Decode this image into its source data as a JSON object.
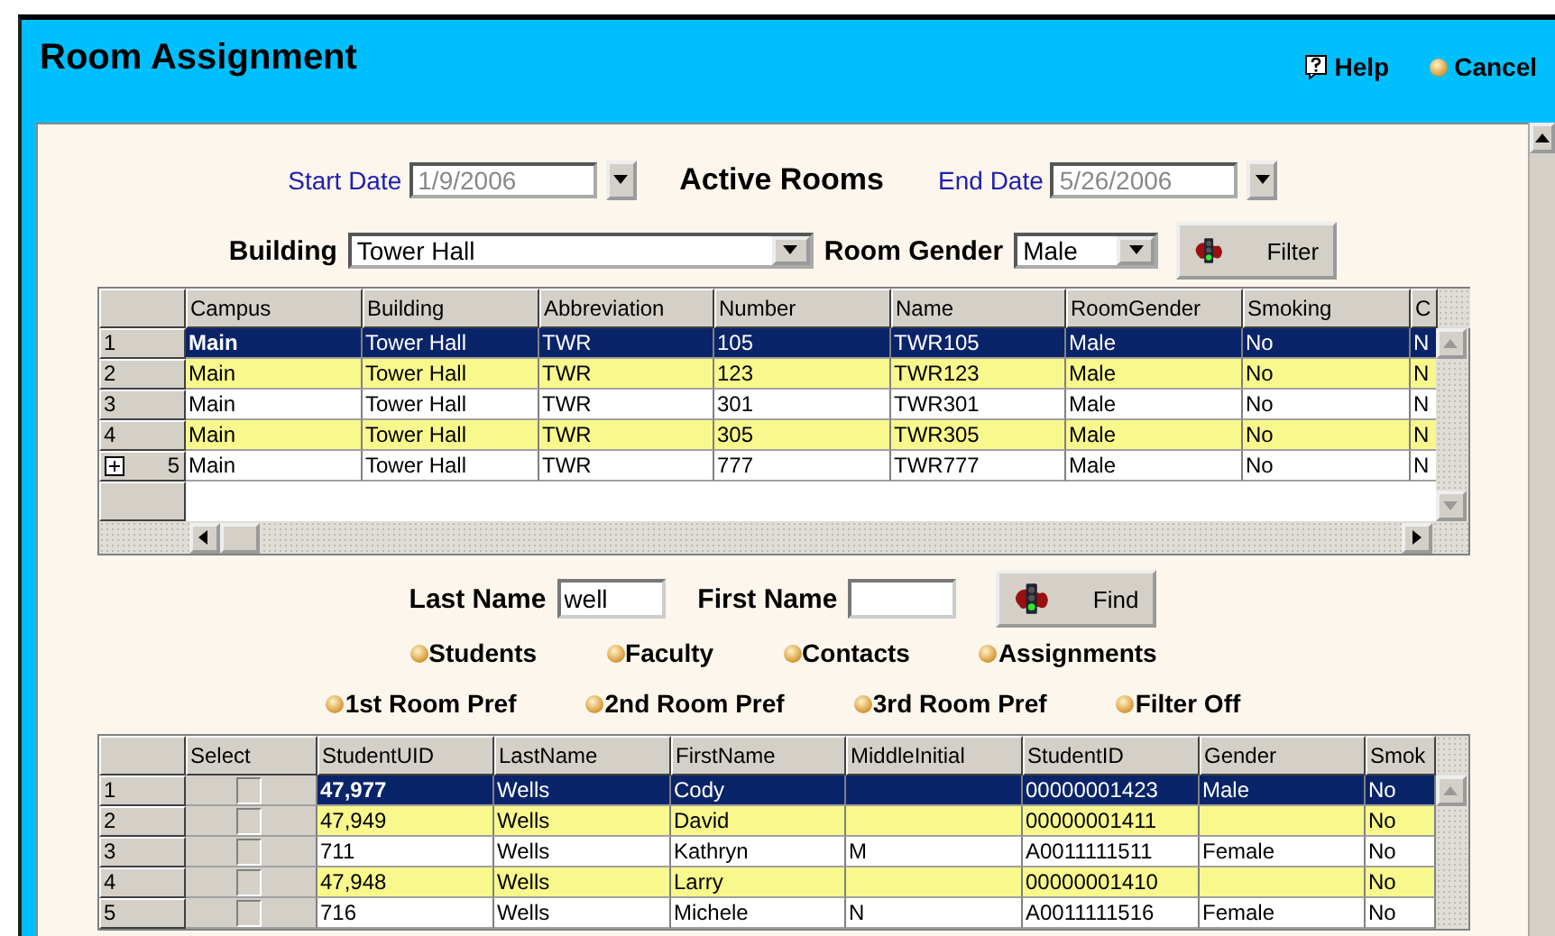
{
  "window": {
    "title": "Room Assignment"
  },
  "header_actions": [
    {
      "kind": "help",
      "label": "Help"
    },
    {
      "kind": "cancel",
      "label": "Cancel"
    }
  ],
  "date_filter": {
    "start_label": "Start Date",
    "start_value": "1/9/2006",
    "title": "Active Rooms",
    "end_label": "End Date",
    "end_value": "5/26/2006"
  },
  "room_filter": {
    "building_label": "Building",
    "building_value": "Tower Hall",
    "gender_label": "Room Gender",
    "gender_value": "Male",
    "button": "Filter"
  },
  "rooms_table": {
    "columns": [
      "Campus",
      "Building",
      "Abbreviation",
      "Number",
      "Name",
      "RoomGender",
      "Smoking",
      "C"
    ],
    "rows": [
      {
        "row_number": "1",
        "selected": true,
        "highlighted": false,
        "expandable": false,
        "cells": [
          "Main",
          "Tower Hall",
          "TWR",
          "105",
          "TWR105",
          "Male",
          "No",
          "N"
        ]
      },
      {
        "row_number": "2",
        "selected": false,
        "highlighted": true,
        "expandable": false,
        "cells": [
          "Main",
          "Tower Hall",
          "TWR",
          "123",
          "TWR123",
          "Male",
          "No",
          "N"
        ]
      },
      {
        "row_number": "3",
        "selected": false,
        "highlighted": false,
        "expandable": false,
        "cells": [
          "Main",
          "Tower Hall",
          "TWR",
          "301",
          "TWR301",
          "Male",
          "No",
          "N"
        ]
      },
      {
        "row_number": "4",
        "selected": false,
        "highlighted": true,
        "expandable": false,
        "cells": [
          "Main",
          "Tower Hall",
          "TWR",
          "305",
          "TWR305",
          "Male",
          "No",
          "N"
        ]
      },
      {
        "row_number": "5",
        "selected": false,
        "highlighted": false,
        "expandable": true,
        "cells": [
          "Main",
          "Tower Hall",
          "TWR",
          "777",
          "TWR777",
          "Male",
          "No",
          "N"
        ]
      }
    ]
  },
  "name_search": {
    "last_label": "Last Name",
    "last_value": "well",
    "first_label": "First Name",
    "button": "Find"
  },
  "view_options": [
    {
      "label": "Students"
    },
    {
      "label": "Faculty"
    },
    {
      "label": "Contacts"
    },
    {
      "label": "Assignments"
    }
  ],
  "filter_options": [
    {
      "label": "1st Room Pref"
    },
    {
      "label": "2nd Room Pref"
    },
    {
      "label": "3rd Room Pref"
    },
    {
      "label": "Filter Off"
    }
  ],
  "students_table": {
    "columns": [
      "Select",
      "StudentUID",
      "LastName",
      "FirstName",
      "MiddleInitial",
      "StudentID",
      "Gender",
      "Smok"
    ],
    "rows": [
      {
        "row_number": "1",
        "selected": true,
        "highlighted": false,
        "checked": false,
        "cells": [
          "",
          "47,977",
          "Wells",
          "Cody",
          "",
          "00000001423",
          "Male",
          "No"
        ]
      },
      {
        "row_number": "2",
        "selected": false,
        "highlighted": true,
        "checked": false,
        "cells": [
          "",
          "47,949",
          "Wells",
          "David",
          "",
          "00000001411",
          "",
          "No"
        ]
      },
      {
        "row_number": "3",
        "selected": false,
        "highlighted": false,
        "checked": false,
        "cells": [
          "",
          "711",
          "Wells",
          "Kathryn",
          "M",
          "A0011111511",
          "Female",
          "No"
        ]
      },
      {
        "row_number": "4",
        "selected": false,
        "highlighted": true,
        "checked": false,
        "cells": [
          "",
          "47,948",
          "Wells",
          "Larry",
          "",
          "00000001410",
          "",
          "No"
        ]
      },
      {
        "row_number": "5",
        "selected": false,
        "highlighted": false,
        "checked": false,
        "cells": [
          "",
          "716",
          "Wells",
          "Michele",
          "N",
          "A0011111516",
          "Female",
          "No"
        ]
      }
    ]
  }
}
